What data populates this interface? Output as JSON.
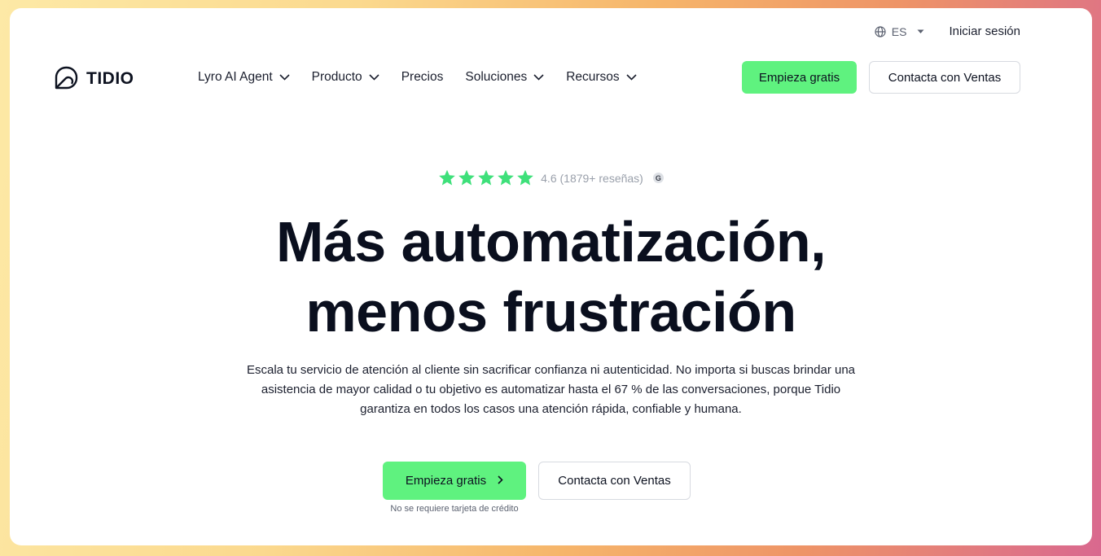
{
  "util": {
    "lang_code": "ES",
    "login_label": "Iniciar sesión"
  },
  "brand": {
    "name": "TIDIO",
    "logo_icon": "tidio-logo-icon",
    "accent": "#5ff27f"
  },
  "nav": {
    "items": [
      {
        "label": "Lyro AI Agent",
        "has_dropdown": true
      },
      {
        "label": "Producto",
        "has_dropdown": true
      },
      {
        "label": "Precios",
        "has_dropdown": false
      },
      {
        "label": "Soluciones",
        "has_dropdown": true
      },
      {
        "label": "Recursos",
        "has_dropdown": true
      }
    ],
    "cta_primary": "Empieza gratis",
    "cta_secondary": "Contacta con Ventas"
  },
  "hero": {
    "rating": {
      "stars": 5,
      "text": "4.6 (1879+ reseñas)",
      "badge": "G",
      "star_color": "#3ee07a"
    },
    "headline_line1": "Más automatización,",
    "headline_line2": "menos frustración",
    "description": "Escala tu servicio de atención al cliente sin sacrificar confianza ni autenticidad. No importa si buscas brindar una asistencia de mayor calidad o tu objetivo es automatizar hasta el 67 % de las conversaciones, porque Tidio garantiza en todos los casos una atención rápida, confiable y humana.",
    "cta_primary": "Empieza gratis",
    "cta_secondary": "Contacta con Ventas",
    "note": "No se requiere tarjeta de crédito"
  }
}
